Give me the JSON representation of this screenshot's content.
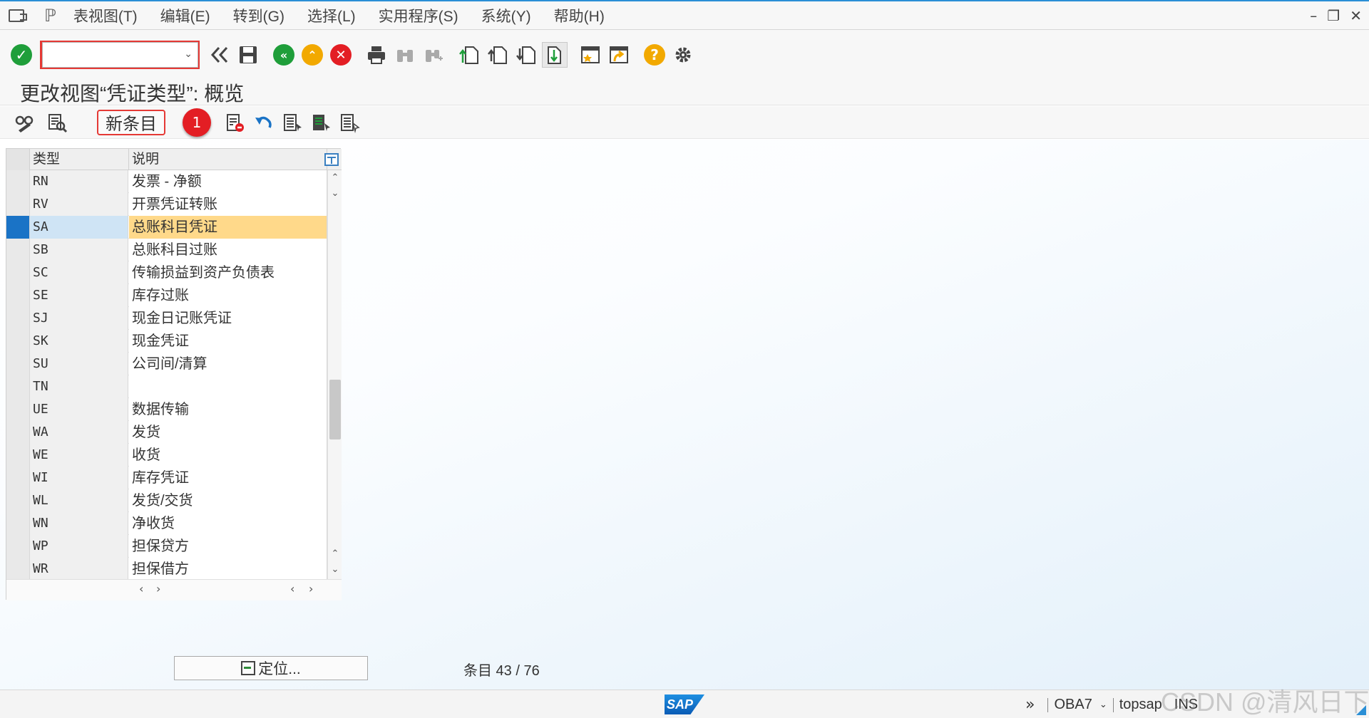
{
  "menubar": {
    "items": [
      "表视图(T)",
      "编辑(E)",
      "转到(G)",
      "选择(L)",
      "实用程序(S)",
      "系统(Y)",
      "帮助(H)"
    ]
  },
  "toolbar": {
    "command_value": "",
    "icons": [
      "enter-icon",
      "command-dropdown-icon",
      "double-chevron-left-icon",
      "save-icon",
      "back-icon",
      "exit-icon",
      "cancel-icon",
      "print-icon",
      "find-icon",
      "find-next-icon",
      "first-page-icon",
      "previous-page-icon",
      "next-page-icon",
      "last-page-icon",
      "create-session-icon",
      "generate-shortcut-icon",
      "help-icon",
      "settings-icon"
    ]
  },
  "page": {
    "title": "更改视图“凭证类型”: 概览"
  },
  "app_toolbar": {
    "new_entry_label": "新条目",
    "badge_label": "1"
  },
  "table": {
    "columns": [
      "类型",
      "说明"
    ],
    "rows": [
      {
        "type": "RN",
        "desc": "发票 - 净额"
      },
      {
        "type": "RV",
        "desc": "开票凭证转账"
      },
      {
        "type": "SA",
        "desc": "总账科目凭证"
      },
      {
        "type": "SB",
        "desc": "总账科目过账"
      },
      {
        "type": "SC",
        "desc": "传输损益到资产负债表"
      },
      {
        "type": "SE",
        "desc": "库存过账"
      },
      {
        "type": "SJ",
        "desc": "现金日记账凭证"
      },
      {
        "type": "SK",
        "desc": "现金凭证"
      },
      {
        "type": "SU",
        "desc": "公司间/清算"
      },
      {
        "type": "TN",
        "desc": ""
      },
      {
        "type": "UE",
        "desc": "数据传输"
      },
      {
        "type": "WA",
        "desc": "发货"
      },
      {
        "type": "WE",
        "desc": "收货"
      },
      {
        "type": "WI",
        "desc": "库存凭证"
      },
      {
        "type": "WL",
        "desc": "发货/交货"
      },
      {
        "type": "WN",
        "desc": "净收货"
      },
      {
        "type": "WP",
        "desc": "担保贷方"
      },
      {
        "type": "WR",
        "desc": "担保借方"
      }
    ],
    "selected_index": 2
  },
  "footer": {
    "locate_label": "定位...",
    "entry_label": "条目",
    "entry_current": "43",
    "entry_total": "76",
    "entry_text": "条目 43 / 76"
  },
  "statusbar": {
    "logo": "SAP",
    "transaction": "OBA7",
    "server": "topsap",
    "mode": "INS"
  },
  "watermark": "CSDN @清风日下",
  "colors": {
    "selected_row_marker": "#1a73c6",
    "selected_row_highlight": "#ffd98a",
    "accent_red": "#e53935",
    "badge_red": "#e31e24",
    "sap_blue": "#1e8fe1"
  }
}
